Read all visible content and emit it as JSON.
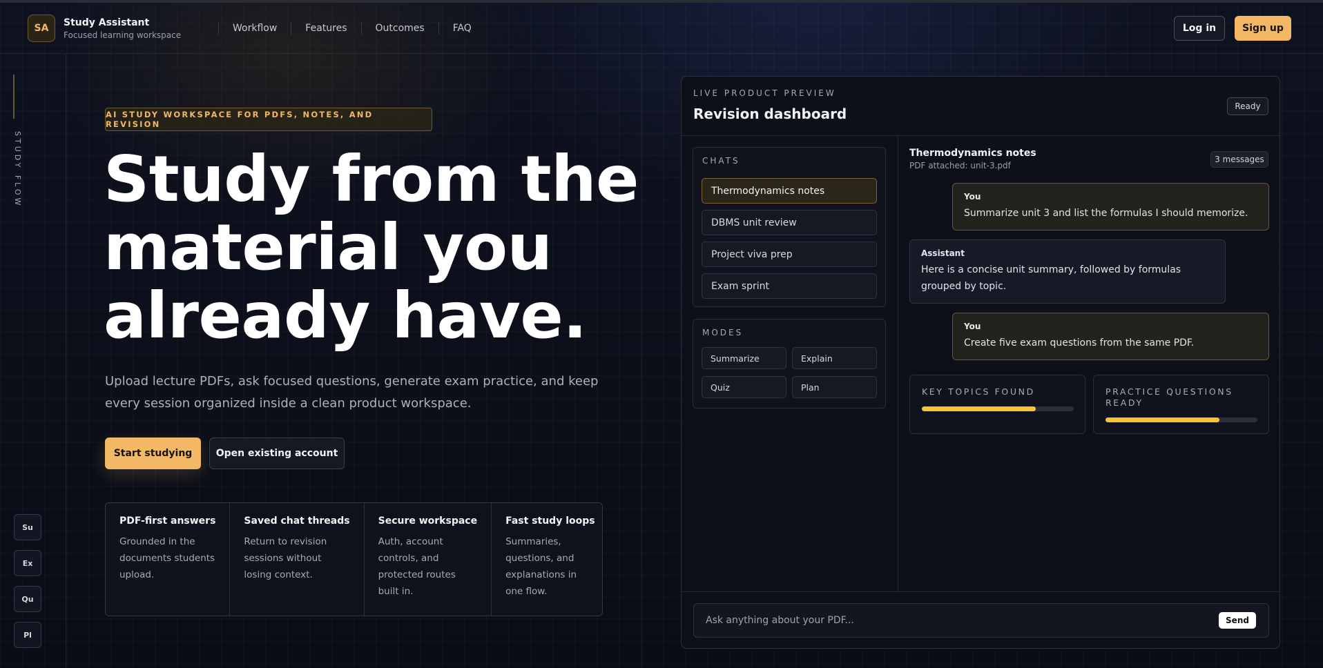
{
  "nav": {
    "logo_initials": "SA",
    "brand_name": "Study Assistant",
    "brand_tagline": "Focused learning workspace",
    "links": [
      "Workflow",
      "Features",
      "Outcomes",
      "FAQ"
    ],
    "login_label": "Log in",
    "signup_label": "Sign up"
  },
  "rail": {
    "label": "STUDY FLOW",
    "shortcuts": [
      "Su",
      "Ex",
      "Qu",
      "Pl"
    ]
  },
  "hero": {
    "eyebrow": "AI STUDY WORKSPACE FOR PDFS, NOTES, AND REVISION",
    "title_lines": [
      "Study from the",
      "material you",
      "already have."
    ],
    "subtitle": "Upload lecture PDFs, ask focused questions, generate exam practice, and keep every session organized inside a clean product workspace.",
    "primary_cta": "Start studying",
    "secondary_cta": "Open existing account"
  },
  "features": [
    {
      "title": "PDF-first answers",
      "desc": "Grounded in the documents students upload."
    },
    {
      "title": "Saved chat threads",
      "desc": "Return to revision sessions without losing context."
    },
    {
      "title": "Secure workspace",
      "desc": "Auth, account controls, and protected routes built in."
    },
    {
      "title": "Fast study loops",
      "desc": "Summaries, questions, and explanations in one flow."
    }
  ],
  "preview": {
    "eyebrow": "LIVE PRODUCT PREVIEW",
    "title": "Revision dashboard",
    "status": "Ready",
    "chats_label": "CHATS",
    "chats": [
      "Thermodynamics notes",
      "DBMS unit review",
      "Project viva prep",
      "Exam sprint"
    ],
    "active_chat_index": 0,
    "modes_label": "MODES",
    "modes": [
      "Summarize",
      "Explain",
      "Quiz",
      "Plan"
    ],
    "conversation": {
      "title": "Thermodynamics notes",
      "attachment": "PDF attached: unit-3.pdf",
      "count": "3 messages",
      "messages": [
        {
          "author": "You",
          "text": "Summarize unit 3 and list the formulas I should memorize."
        },
        {
          "author": "Assistant",
          "text": "Here is a concise unit summary, followed by formulas grouped by topic."
        },
        {
          "author": "You",
          "text": "Create five exam questions from the same PDF."
        }
      ]
    },
    "stats": [
      {
        "label": "KEY TOPICS FOUND",
        "progress": 0.75
      },
      {
        "label": "PRACTICE QUESTIONS READY",
        "progress": 0.75
      }
    ],
    "input_placeholder": "Ask anything about your PDF...",
    "send_label": "Send"
  },
  "colors": {
    "accent": "#f3b865",
    "progress": "#f7c531",
    "background": "#0c0f19"
  }
}
